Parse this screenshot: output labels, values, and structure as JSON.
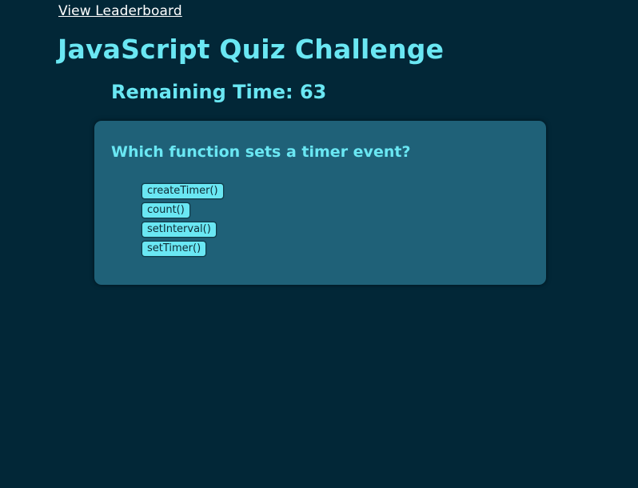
{
  "header": {
    "leaderboard_link": "View Leaderboard",
    "title": "JavaScript Quiz Challenge"
  },
  "timer": {
    "text": "Remaining Time: 63"
  },
  "quiz": {
    "question": "Which function sets a timer event?",
    "choices": [
      {
        "label": "createTimer()"
      },
      {
        "label": "count()"
      },
      {
        "label": "setInterval()"
      },
      {
        "label": "setTimer()"
      }
    ]
  },
  "colors": {
    "background": "#022737",
    "card": "#1f6178",
    "accent": "#6ae7f3",
    "link": "#ffffff"
  }
}
